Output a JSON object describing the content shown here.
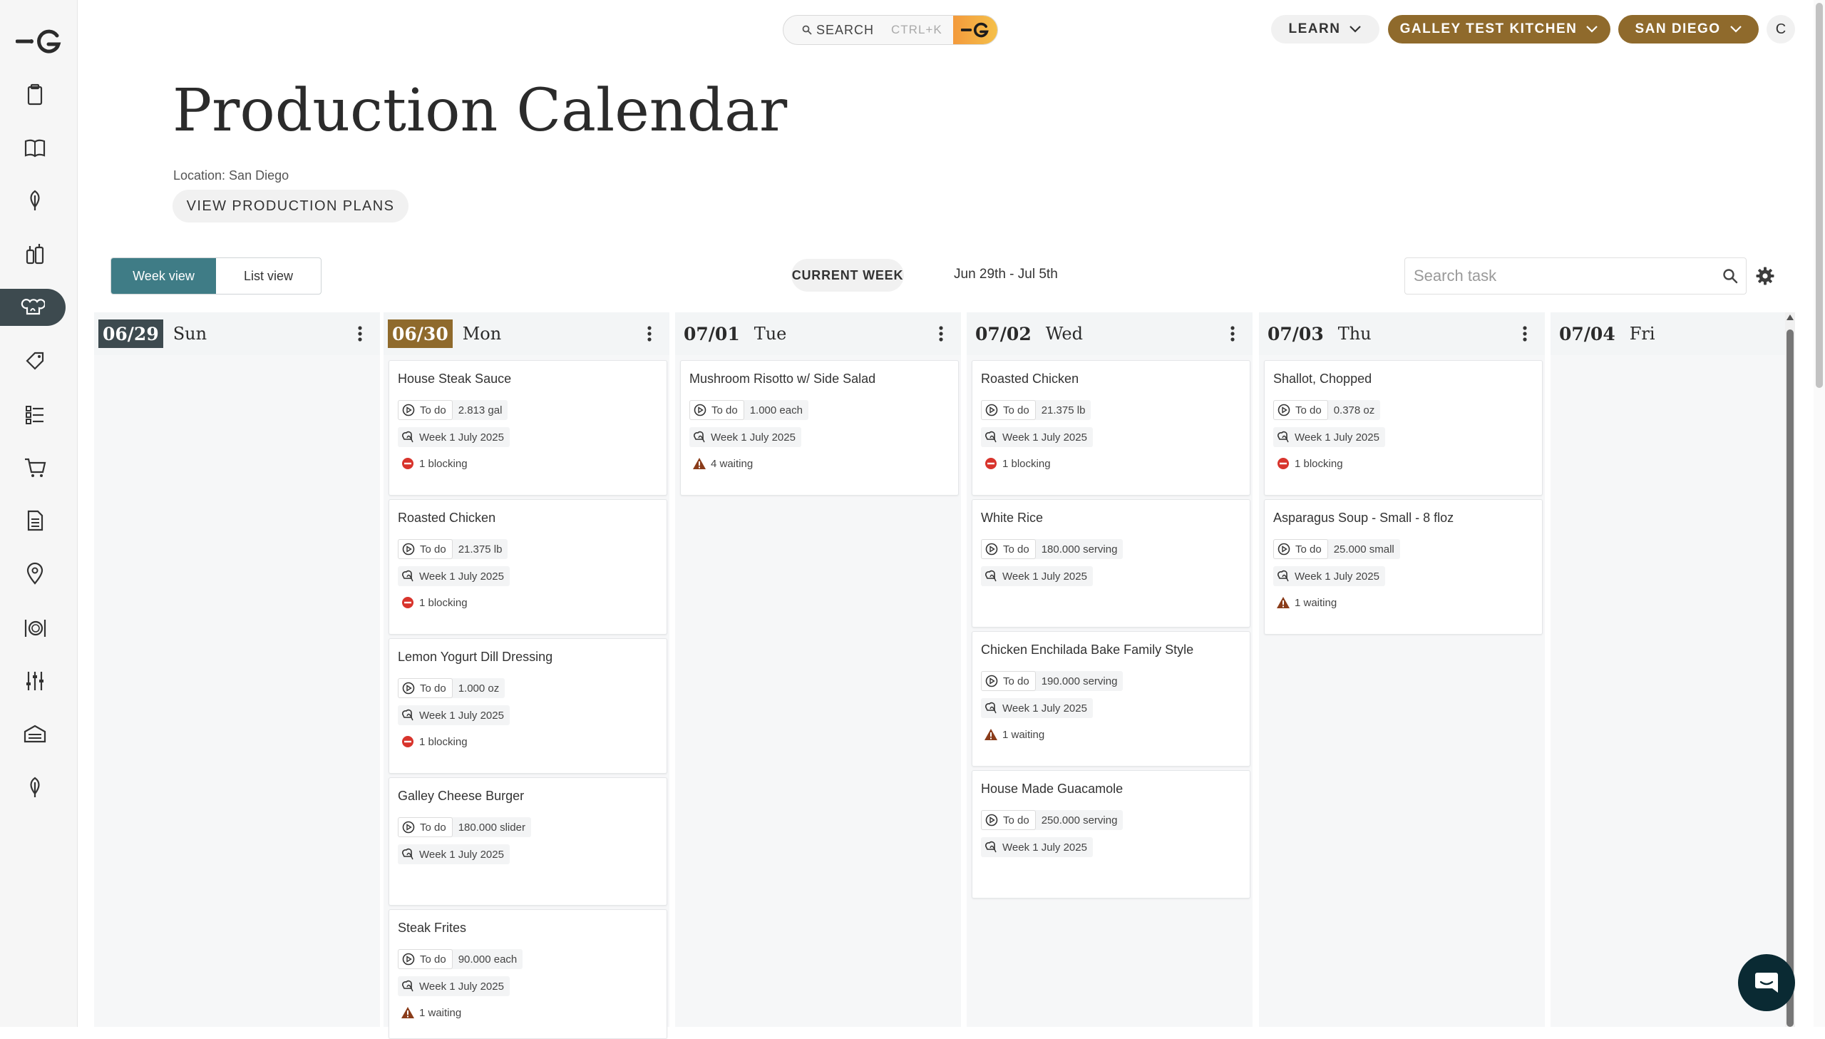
{
  "topbar": {
    "search_label": "SEARCH",
    "search_shortcut": "CTRL+K",
    "learn_label": "LEARN",
    "kitchen_label": "GALLEY TEST KITCHEN",
    "city_label": "SAN DIEGO",
    "avatar_initial": "C"
  },
  "page": {
    "title": "Production Calendar",
    "location": "Location: San Diego",
    "view_plans_label": "VIEW PRODUCTION PLANS"
  },
  "toolbar": {
    "week_view": "Week view",
    "list_view": "List view",
    "current_week": "CURRENT WEEK",
    "date_range": "Jun 29th - Jul 5th",
    "search_placeholder": "Search task"
  },
  "colors": {
    "brand_gold": "#8f6a2c",
    "teal_active": "#3f7c86",
    "sidebar_active": "#3d4a4f",
    "blocking_red": "#d8342c",
    "waiting_brown": "#8a3c1a"
  },
  "days": [
    {
      "date": "06/29",
      "dow": "Sun",
      "cards": []
    },
    {
      "date": "06/30",
      "dow": "Mon",
      "cards": [
        {
          "title": "House Steak Sauce",
          "status": "To do",
          "qty": "2.813 gal",
          "plan": "Week 1 July 2025",
          "flag": "1 blocking",
          "flag_type": "blocking"
        },
        {
          "title": "Roasted Chicken",
          "status": "To do",
          "qty": "21.375 lb",
          "plan": "Week 1 July 2025",
          "flag": "1 blocking",
          "flag_type": "blocking"
        },
        {
          "title": "Lemon Yogurt Dill Dressing",
          "status": "To do",
          "qty": "1.000 oz",
          "plan": "Week 1 July 2025",
          "flag": "1 blocking",
          "flag_type": "blocking"
        },
        {
          "title": "Galley Cheese Burger",
          "status": "To do",
          "qty": "180.000 slider",
          "plan": "Week 1 July 2025",
          "flag": "",
          "flag_type": ""
        },
        {
          "title": "Steak Frites",
          "status": "To do",
          "qty": "90.000 each",
          "plan": "Week 1 July 2025",
          "flag": "1 waiting",
          "flag_type": "waiting"
        }
      ]
    },
    {
      "date": "07/01",
      "dow": "Tue",
      "cards": [
        {
          "title": "Mushroom Risotto w/ Side Salad",
          "status": "To do",
          "qty": "1.000 each",
          "plan": "Week 1 July 2025",
          "flag": "4 waiting",
          "flag_type": "waiting"
        }
      ]
    },
    {
      "date": "07/02",
      "dow": "Wed",
      "cards": [
        {
          "title": "Roasted Chicken",
          "status": "To do",
          "qty": "21.375 lb",
          "plan": "Week 1 July 2025",
          "flag": "1 blocking",
          "flag_type": "blocking"
        },
        {
          "title": "White Rice",
          "status": "To do",
          "qty": "180.000 serving",
          "plan": "Week 1 July 2025",
          "flag": "",
          "flag_type": ""
        },
        {
          "title": "Chicken Enchilada Bake Family Style",
          "status": "To do",
          "qty": "190.000 serving",
          "plan": "Week 1 July 2025",
          "flag": "1 waiting",
          "flag_type": "waiting"
        },
        {
          "title": "House Made Guacamole",
          "status": "To do",
          "qty": "250.000 serving",
          "plan": "Week 1 July 2025",
          "flag": "",
          "flag_type": ""
        }
      ]
    },
    {
      "date": "07/03",
      "dow": "Thu",
      "cards": [
        {
          "title": "Shallot, Chopped",
          "status": "To do",
          "qty": "0.378 oz",
          "plan": "Week 1 July 2025",
          "flag": "1 blocking",
          "flag_type": "blocking"
        },
        {
          "title": "Asparagus Soup - Small - 8 floz",
          "status": "To do",
          "qty": "25.000 small",
          "plan": "Week 1 July 2025",
          "flag": "1 waiting",
          "flag_type": "waiting"
        }
      ]
    },
    {
      "date": "07/04",
      "dow": "Fri",
      "cards": []
    }
  ],
  "sidebar_icons": [
    "clipboard-icon",
    "book-icon",
    "leaf-icon",
    "bottles-icon",
    "chef-hat-icon",
    "tag-icon",
    "checklist-icon",
    "cart-icon",
    "document-icon",
    "location-pin-icon",
    "dining-icon",
    "sliders-icon",
    "warehouse-icon",
    "leaf-icon"
  ]
}
